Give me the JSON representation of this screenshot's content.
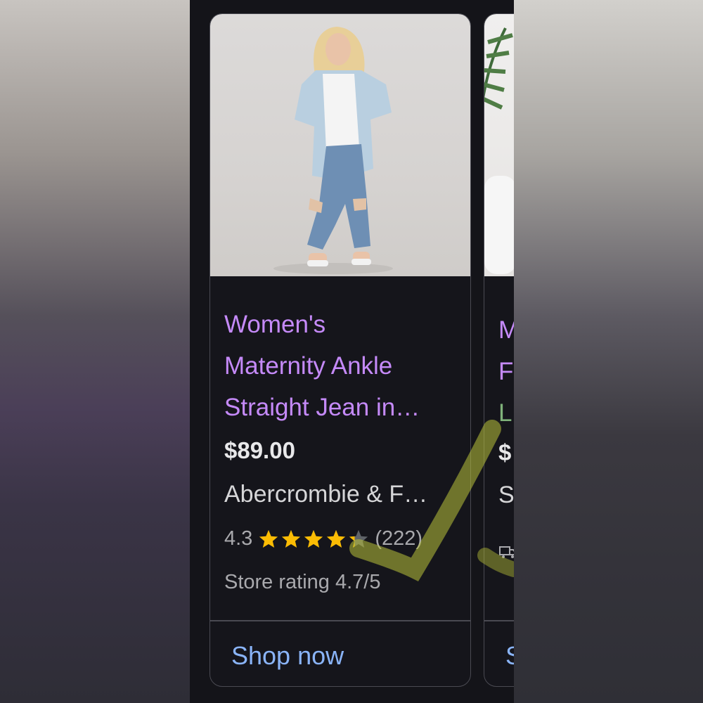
{
  "product": {
    "title_lines": [
      "Women's",
      "Maternity Ankle",
      "Straight Jean in…"
    ],
    "price": "$89.00",
    "merchant": "Abercrombie & F…",
    "rating": "4.3",
    "rating_value": 4.3,
    "rating_max": 5,
    "review_count": "(222)",
    "store_rating": "Store rating 4.7/5",
    "shop_label": "Shop now"
  },
  "next_product": {
    "title_lines": [
      "M",
      "F",
      "L"
    ],
    "price": "$",
    "merchant": "S",
    "shop_label": "S"
  },
  "colors": {
    "title": "#c58af9",
    "link": "#8ab4f8",
    "star": "#fbbc04",
    "card_bg": "#15151b",
    "card_border": "#4a4a52"
  },
  "icons": [
    "star-icon",
    "delivery-truck-icon"
  ]
}
